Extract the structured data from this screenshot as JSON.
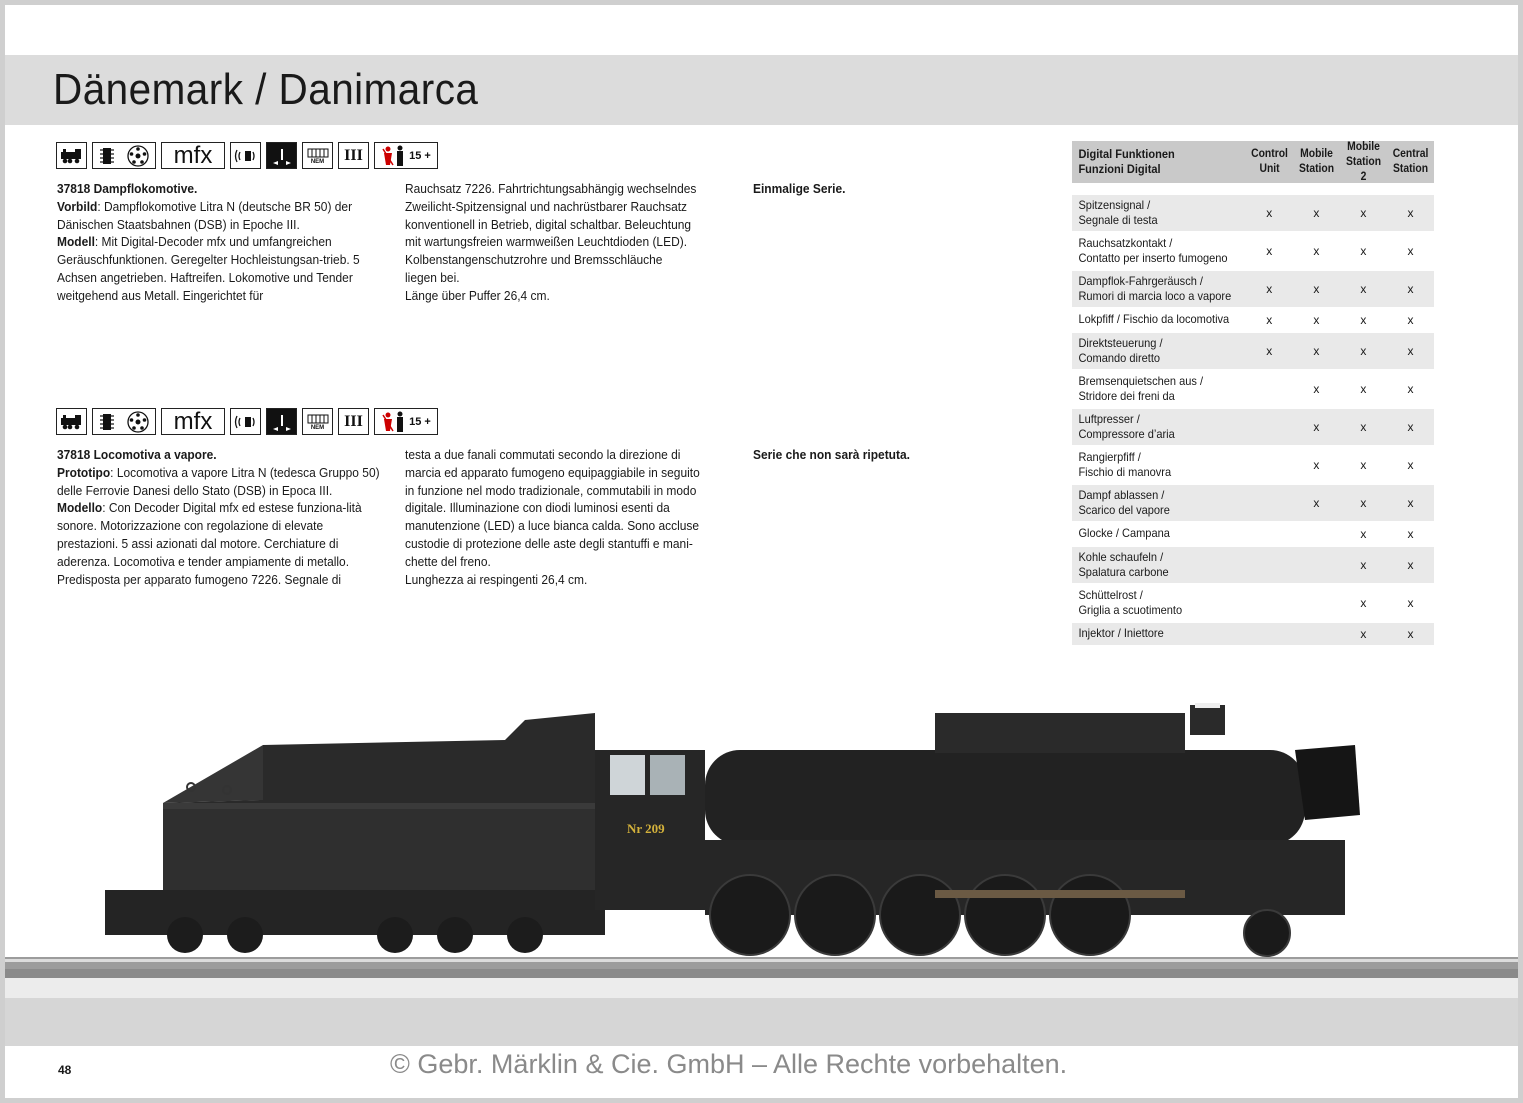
{
  "header": {
    "title": "Dänemark / Danimarca"
  },
  "icons": {
    "mfx_label": "mfx",
    "age_label": "15 +",
    "epoch_label": "III",
    "nem_label": "NEM"
  },
  "product_de": {
    "col1": [
      {
        "bold": "37818 Dampflokomotive.",
        "text": ""
      },
      {
        "bold": "Vorbild",
        "text": ": Dampflokomotive Litra N (deutsche BR 50) der Dänischen Staatsbahnen (DSB) in Epoche III."
      },
      {
        "bold": "Modell",
        "text": ": Mit Digital-Decoder mfx und umfangreichen Geräuschfunktionen. Geregelter Hochleistungsan-trieb. 5 Achsen angetrieben. Haftreifen. Lokomotive und Tender weitgehend aus Metall. Eingerichtet für"
      }
    ],
    "col2": "Rauchsatz 7226. Fahrtrichtungsabhängig wechselndes\nZweilicht-Spitzensignal und nachrüstbarer Rauchsatz\nkonventionell in Betrieb, digital schaltbar. Beleuchtung\nmit wartungsfreien warmweißen Leuchtdioden (LED).\nKolbenstangenschutzrohre und Bremsschläuche\nliegen bei.\nLänge über Puffer 26,4 cm.",
    "note": "Einmalige Serie."
  },
  "product_it": {
    "col1": [
      {
        "bold": "37818 Locomotiva a vapore.",
        "text": ""
      },
      {
        "bold": "Prototipo",
        "text": ": Locomotiva a vapore Litra N (tedesca Gruppo 50) delle Ferrovie Danesi dello Stato (DSB) in Epoca III."
      },
      {
        "bold": "Modello",
        "text": ": Con Decoder Digital mfx ed estese funziona-lità sonore. Motorizzazione con regolazione di elevate prestazioni. 5 assi azionati dal motore. Cerchiature di aderenza. Locomotiva e tender ampiamente di metallo. Predisposta per apparato fumogeno 7226. Segnale di"
      }
    ],
    "col2": "testa a due fanali commutati secondo la direzione di\nmarcia ed apparato fumogeno equipaggiabile in seguito\nin funzione nel modo tradizionale, commutabili in modo\ndigitale. Illuminazione con diodi luminosi esenti da\nmanutenzione (LED) a luce bianca calda. Sono accluse\ncustodie di protezione delle aste degli stantuffi e mani-\nchette del freno.\nLunghezza ai respingenti 26,4 cm.",
    "note": "Serie che non sarà ripetuta."
  },
  "digital_table": {
    "header": {
      "label": "Digital Funktionen\nFunzioni Digital",
      "cols": [
        "Control\nUnit",
        "Mobile\nStation",
        "Mobile\nStation 2",
        "Central\nStation"
      ]
    },
    "rows": [
      {
        "label": "Spitzensignal /\nSegnale di testa",
        "marks": [
          "x",
          "x",
          "x",
          "x"
        ]
      },
      {
        "label": "Rauchsatzkontakt /\nContatto per inserto fumogeno",
        "marks": [
          "x",
          "x",
          "x",
          "x"
        ]
      },
      {
        "label": "Dampflok-Fahrgeräusch /\nRumori di marcia loco a vapore",
        "marks": [
          "x",
          "x",
          "x",
          "x"
        ]
      },
      {
        "label": "Lokpfiff / Fischio da locomotiva",
        "marks": [
          "x",
          "x",
          "x",
          "x"
        ]
      },
      {
        "label": "Direktsteuerung /\nComando diretto",
        "marks": [
          "x",
          "x",
          "x",
          "x"
        ]
      },
      {
        "label": "Bremsenquietschen aus /\nStridore dei freni da",
        "marks": [
          "",
          "x",
          "x",
          "x"
        ]
      },
      {
        "label": "Luftpresser /\nCompressore d’aria",
        "marks": [
          "",
          "x",
          "x",
          "x"
        ]
      },
      {
        "label": "Rangierpfiff /\nFischio di manovra",
        "marks": [
          "",
          "x",
          "x",
          "x"
        ]
      },
      {
        "label": "Dampf ablassen /\nScarico del vapore",
        "marks": [
          "",
          "x",
          "x",
          "x"
        ]
      },
      {
        "label": "Glocke / Campana",
        "marks": [
          "",
          "",
          "x",
          "x"
        ]
      },
      {
        "label": "Kohle schaufeln /\nSpalatura carbone",
        "marks": [
          "",
          "",
          "x",
          "x"
        ]
      },
      {
        "label": "Schüttelrost /\nGriglia a scuotimento",
        "marks": [
          "",
          "",
          "x",
          "x"
        ]
      },
      {
        "label": "Injektor / Iniettore",
        "marks": [
          "",
          "",
          "x",
          "x"
        ]
      }
    ]
  },
  "locomotive": {
    "number_plate": "Nr 209"
  },
  "footer": {
    "page_number": "48",
    "copyright": "© Gebr. Märklin & Cie. GmbH – Alle Rechte vorbehalten."
  }
}
